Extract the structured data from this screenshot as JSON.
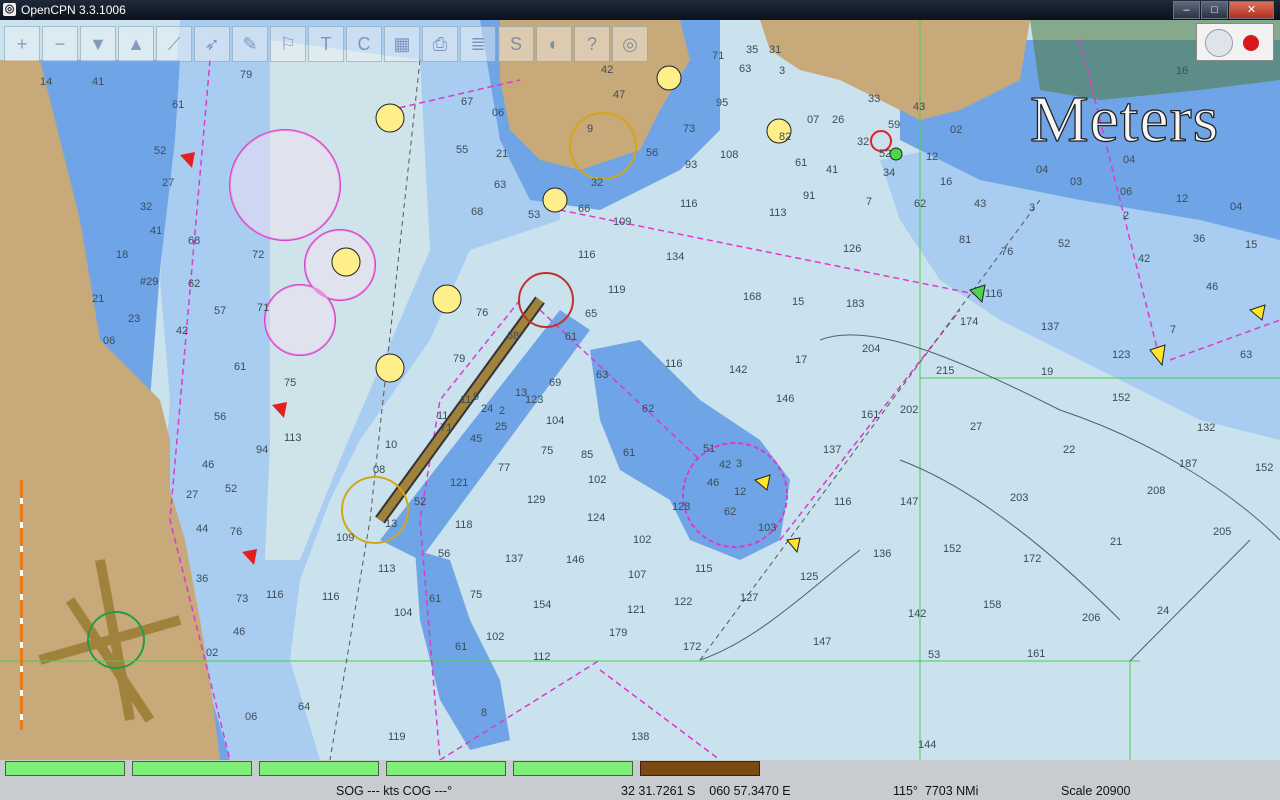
{
  "window": {
    "title": "OpenCPN 3.3.1006",
    "app_icon": "opencpn-icon"
  },
  "toolbar": {
    "buttons": [
      {
        "name": "zoom-in-icon",
        "glyph": "+"
      },
      {
        "name": "zoom-out-icon",
        "glyph": "−"
      },
      {
        "name": "scale-in-icon",
        "glyph": "▼"
      },
      {
        "name": "scale-out-icon",
        "glyph": "▲"
      },
      {
        "name": "route-icon",
        "glyph": "⟋"
      },
      {
        "name": "follow-icon",
        "glyph": "➶"
      },
      {
        "name": "settings-icon",
        "glyph": "✎"
      },
      {
        "name": "text-icon",
        "glyph": "⚐"
      },
      {
        "name": "tide-icon",
        "glyph": "T"
      },
      {
        "name": "current-icon",
        "glyph": "C"
      },
      {
        "name": "chart-quilting-icon",
        "glyph": "▦"
      },
      {
        "name": "print-icon",
        "glyph": "⎙"
      },
      {
        "name": "route-manager-icon",
        "glyph": "≣"
      },
      {
        "name": "track-icon",
        "glyph": "S"
      },
      {
        "name": "color-scheme-icon",
        "glyph": "◐"
      },
      {
        "name": "help-icon",
        "glyph": "?"
      },
      {
        "name": "mob-icon",
        "glyph": "◎"
      }
    ]
  },
  "chart": {
    "depth_units": "Meters",
    "soundings": [
      [
        "14",
        40,
        85
      ],
      [
        "41",
        92,
        85
      ],
      [
        "79",
        240,
        78
      ],
      [
        "61",
        172,
        108
      ],
      [
        "52",
        154,
        154
      ],
      [
        "27",
        162,
        186
      ],
      [
        "32",
        140,
        210
      ],
      [
        "41",
        150,
        234
      ],
      [
        "68",
        188,
        244
      ],
      [
        "72",
        252,
        258
      ],
      [
        "18",
        116,
        258
      ],
      [
        "#29",
        140,
        285
      ],
      [
        "62",
        188,
        287
      ],
      [
        "21",
        92,
        302
      ],
      [
        "23",
        128,
        322
      ],
      [
        "06",
        103,
        344
      ],
      [
        "42",
        176,
        334
      ],
      [
        "61",
        234,
        370
      ],
      [
        "75",
        284,
        386
      ],
      [
        "56",
        214,
        420
      ],
      [
        "94",
        256,
        453
      ],
      [
        "46",
        202,
        468
      ],
      [
        "52",
        225,
        492
      ],
      [
        "27",
        186,
        498
      ],
      [
        "44",
        196,
        532
      ],
      [
        "76",
        230,
        535
      ],
      [
        "36",
        196,
        582
      ],
      [
        "73",
        236,
        602
      ],
      [
        "46",
        233,
        635
      ],
      [
        "02",
        206,
        656
      ],
      [
        "116",
        266,
        598
      ],
      [
        "116",
        322,
        600
      ],
      [
        "113",
        378,
        572
      ],
      [
        "104",
        394,
        616
      ],
      [
        "06",
        245,
        720
      ],
      [
        "64",
        298,
        710
      ],
      [
        "119",
        388,
        740
      ],
      [
        "138",
        631,
        740
      ],
      [
        "144",
        918,
        748
      ],
      [
        "8",
        481,
        716
      ],
      [
        "61",
        455,
        650
      ],
      [
        "102",
        486,
        640
      ],
      [
        "56",
        438,
        557
      ],
      [
        "61",
        429,
        602
      ],
      [
        "75",
        470,
        598
      ],
      [
        "112",
        533,
        660
      ],
      [
        "179",
        609,
        636
      ],
      [
        "172",
        683,
        650
      ],
      [
        "147",
        813,
        645
      ],
      [
        "142",
        908,
        617
      ],
      [
        "158",
        983,
        608
      ],
      [
        "53",
        928,
        658
      ],
      [
        "161",
        1027,
        657
      ],
      [
        "206",
        1082,
        621
      ],
      [
        "24",
        1157,
        614
      ],
      [
        "121",
        627,
        613
      ],
      [
        "152",
        943,
        552
      ],
      [
        "172",
        1023,
        562
      ],
      [
        "21",
        1110,
        545
      ],
      [
        "205",
        1213,
        535
      ],
      [
        "208",
        1147,
        494
      ],
      [
        "203",
        1010,
        501
      ],
      [
        "22",
        1063,
        453
      ],
      [
        "152",
        1112,
        401
      ],
      [
        "132",
        1197,
        431
      ],
      [
        "187",
        1179,
        467
      ],
      [
        "152",
        1255,
        471
      ],
      [
        "27",
        970,
        430
      ],
      [
        "202",
        900,
        413
      ],
      [
        "161",
        861,
        418
      ],
      [
        "137",
        823,
        453
      ],
      [
        "146",
        776,
        402
      ],
      [
        "142",
        729,
        373
      ],
      [
        "116",
        665,
        367
      ],
      [
        "17",
        795,
        363
      ],
      [
        "204",
        862,
        352
      ],
      [
        "215",
        936,
        374
      ],
      [
        "19",
        1041,
        375
      ],
      [
        "123",
        1112,
        358
      ],
      [
        "137",
        1041,
        330
      ],
      [
        "174",
        960,
        325
      ],
      [
        "63",
        1240,
        358
      ],
      [
        "7",
        1170,
        333
      ],
      [
        "46",
        1206,
        290
      ],
      [
        "42",
        1138,
        262
      ],
      [
        "52",
        1058,
        247
      ],
      [
        "76",
        1001,
        255
      ],
      [
        "116",
        985,
        297
      ],
      [
        "81",
        959,
        243
      ],
      [
        "15",
        1245,
        248
      ],
      [
        "36",
        1193,
        242
      ],
      [
        "12",
        1176,
        202
      ],
      [
        "04",
        1230,
        210
      ],
      [
        "2",
        1123,
        219
      ],
      [
        "06",
        1120,
        195
      ],
      [
        "03",
        1070,
        185
      ],
      [
        "04",
        1123,
        163
      ],
      [
        "04",
        1036,
        173
      ],
      [
        "43",
        974,
        207
      ],
      [
        "16",
        940,
        185
      ],
      [
        "3",
        1029,
        211
      ],
      [
        "02",
        950,
        133
      ],
      [
        "12",
        926,
        160
      ],
      [
        "43",
        913,
        110
      ],
      [
        "16",
        1176,
        74
      ],
      [
        "34",
        883,
        176
      ],
      [
        "59",
        888,
        128
      ],
      [
        "52",
        879,
        157
      ],
      [
        "62",
        914,
        207
      ],
      [
        "7",
        866,
        205
      ],
      [
        "32",
        857,
        145
      ],
      [
        "41",
        826,
        173
      ],
      [
        "61",
        795,
        166
      ],
      [
        "91",
        803,
        199
      ],
      [
        "82",
        779,
        140
      ],
      [
        "07",
        807,
        123
      ],
      [
        "26",
        832,
        123
      ],
      [
        "33",
        868,
        102
      ],
      [
        "63",
        739,
        72
      ],
      [
        "71",
        712,
        59
      ],
      [
        "35",
        746,
        53
      ],
      [
        "31",
        769,
        53
      ],
      [
        "3",
        779,
        74
      ],
      [
        "95",
        716,
        106
      ],
      [
        "108",
        720,
        158
      ],
      [
        "113",
        769,
        216
      ],
      [
        "126",
        843,
        252
      ],
      [
        "183",
        846,
        307
      ],
      [
        "15",
        792,
        305
      ],
      [
        "168",
        743,
        300
      ],
      [
        "134",
        666,
        260
      ],
      [
        "109",
        613,
        225
      ],
      [
        "116",
        578,
        258
      ],
      [
        "119",
        608,
        293
      ],
      [
        "116",
        680,
        207
      ],
      [
        "93",
        685,
        168
      ],
      [
        "56",
        646,
        156
      ],
      [
        "73",
        683,
        132
      ],
      [
        "06",
        492,
        116
      ],
      [
        "21",
        496,
        157
      ],
      [
        "63",
        494,
        188
      ],
      [
        "53",
        528,
        218
      ],
      [
        "66",
        578,
        212
      ],
      [
        "32",
        591,
        186
      ],
      [
        "47",
        613,
        98
      ],
      [
        "42",
        601,
        73
      ],
      [
        "67",
        461,
        105
      ],
      [
        "55",
        456,
        153
      ],
      [
        "68",
        471,
        215
      ],
      [
        "9",
        587,
        132
      ],
      [
        "65",
        585,
        317
      ],
      [
        "61",
        565,
        340
      ],
      [
        "63",
        596,
        378
      ],
      [
        "62",
        642,
        412
      ],
      [
        "69",
        549,
        386
      ],
      [
        "68",
        507,
        339
      ],
      [
        "76",
        476,
        316
      ],
      [
        "13",
        515,
        396
      ],
      [
        "123",
        525,
        403
      ],
      [
        "104",
        546,
        424
      ],
      [
        "75",
        541,
        454
      ],
      [
        "51",
        703,
        452
      ],
      [
        "42",
        719,
        468
      ],
      [
        "3",
        736,
        467
      ],
      [
        "46",
        707,
        486
      ],
      [
        "12",
        734,
        495
      ],
      [
        "62",
        724,
        515
      ],
      [
        "128",
        672,
        510
      ],
      [
        "103",
        758,
        531
      ],
      [
        "116",
        834,
        505
      ],
      [
        "147",
        900,
        505
      ],
      [
        "136",
        873,
        557
      ],
      [
        "125",
        800,
        580
      ],
      [
        "115",
        695,
        572
      ],
      [
        "122",
        674,
        605
      ],
      [
        "127",
        740,
        601
      ],
      [
        "107",
        628,
        578
      ],
      [
        "102",
        633,
        543
      ],
      [
        "146",
        566,
        563
      ],
      [
        "154",
        533,
        608
      ],
      [
        "137",
        505,
        562
      ],
      [
        "124",
        587,
        521
      ],
      [
        "129",
        527,
        503
      ],
      [
        "102",
        588,
        483
      ],
      [
        "85",
        581,
        458
      ],
      [
        "61",
        623,
        456
      ],
      [
        "71",
        440,
        431
      ],
      [
        "11",
        437,
        419
      ],
      [
        "25",
        495,
        430
      ],
      [
        "45",
        470,
        442
      ],
      [
        "77",
        498,
        471
      ],
      [
        "121",
        450,
        486
      ],
      [
        "9",
        473,
        400
      ],
      [
        "24",
        481,
        412
      ],
      [
        "11",
        460,
        403
      ],
      [
        "2",
        499,
        414
      ],
      [
        "08",
        373,
        473
      ],
      [
        "52",
        414,
        505
      ],
      [
        "13",
        385,
        527
      ],
      [
        "118",
        455,
        528
      ],
      [
        "109",
        336,
        541
      ],
      [
        "10",
        385,
        448
      ],
      [
        "79",
        453,
        362
      ],
      [
        "113",
        284,
        441
      ],
      [
        "57",
        214,
        314
      ],
      [
        "71",
        257,
        311
      ]
    ],
    "labels_nuances": {
      "rocks": "*"
    }
  },
  "status": {
    "sog_cog": "SOG --- kts COG ---°",
    "position": "32 31.7261 S    060 57.3470 E",
    "bearing_range": "115°  7703 NMi",
    "scale": "Scale 20900"
  },
  "piano_bar": [
    "chart-1",
    "chart-2",
    "chart-3",
    "chart-4",
    "chart-5",
    "chart-6"
  ],
  "colors": {
    "land": "#c8a97a",
    "shallow": "#6fa5e6",
    "medium": "#a9cdf1",
    "deep": "#c9e2ee",
    "nav_line": "#d93cc9"
  }
}
